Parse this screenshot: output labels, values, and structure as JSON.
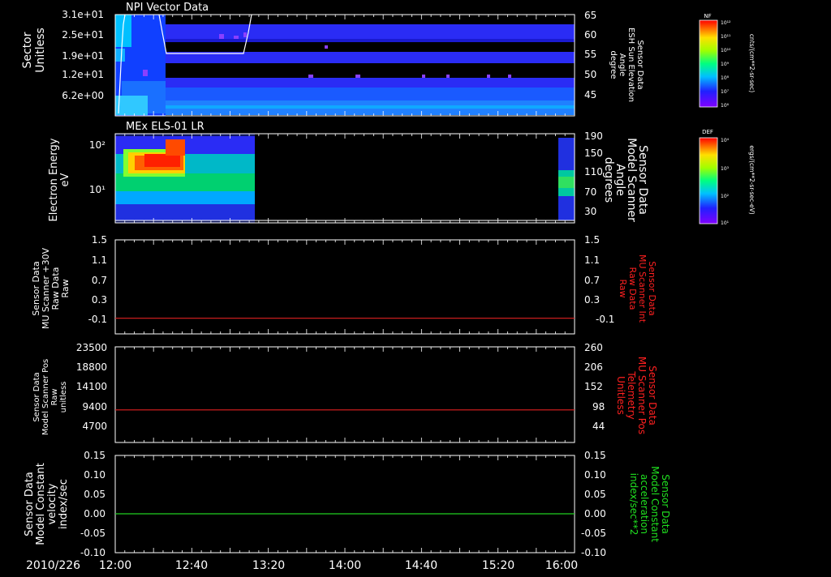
{
  "date_label": "2010/226",
  "time_ticks": [
    "12:00",
    "12:40",
    "13:20",
    "14:00",
    "14:40",
    "15:20",
    "16:00"
  ],
  "chart_data": [
    {
      "type": "heatmap",
      "title": "NPI Vector Data",
      "ylabel": [
        "Sector",
        "Unitless"
      ],
      "y_ticks": [
        "3.1e+01",
        "2.5e+01",
        "1.9e+01",
        "1.2e+01",
        "6.2e+00"
      ],
      "right_label": [
        "Sensor Data",
        "ESH Sun Elevation",
        "Angle",
        "degree"
      ],
      "right_ticks": [
        "65",
        "60",
        "55",
        "50",
        "45"
      ],
      "colorbar": {
        "tag": "NF",
        "ticks": [
          "10¹²",
          "10¹¹",
          "10¹⁰",
          "10⁹",
          "10⁸",
          "10⁷",
          "10⁶"
        ],
        "units": "cnts/(cm**2-sr-sec)"
      }
    },
    {
      "type": "heatmap",
      "title": "MEx ELS-01 LR",
      "ylabel": [
        "Electron Energy",
        "eV"
      ],
      "y_ticks": [
        "10²",
        "10¹"
      ],
      "right_label": [
        "Sensor Data",
        "Model Scanner",
        "Angle",
        "degrees"
      ],
      "right_ticks": [
        "190",
        "150",
        "110",
        "70",
        "30"
      ],
      "colorbar": {
        "tag": "DEF",
        "ticks": [
          "10⁴",
          "10³",
          "10²",
          "10¹"
        ],
        "units": "ergs/(cm**2-sr-sec-eV)"
      }
    },
    {
      "type": "line",
      "ylabel": [
        "Sensor Data",
        "MU Scanner +30V",
        "Raw Data",
        "Raw"
      ],
      "y_ticks": [
        "1.5",
        "1.1",
        "0.7",
        "0.3",
        "-0.1"
      ],
      "ylim": [
        -0.3,
        1.5
      ],
      "right_label": [
        "Sensor Data",
        "MU Scanner Int",
        "Raw Data",
        "Raw"
      ],
      "right_ticks": [
        "1.5",
        "1.1",
        "0.7",
        "0.3",
        "-0.1"
      ],
      "right_color": "#ff2020",
      "series": [
        {
          "color": "#e02020",
          "x": [
            "12:00",
            "16:00"
          ],
          "values": [
            0.0,
            0.0
          ]
        }
      ]
    },
    {
      "type": "line",
      "ylabel": [
        "Sensor Data",
        "Model Scanner Pos",
        "Raw",
        "unitless"
      ],
      "y_ticks": [
        "23500",
        "18800",
        "14100",
        "9400",
        "4700"
      ],
      "ylim": [
        0,
        23500
      ],
      "right_label": [
        "Sensor Data",
        "MU Scanner Pos",
        "Telemetry",
        "Unitless"
      ],
      "right_ticks": [
        "260",
        "206",
        "152",
        "98",
        "44"
      ],
      "right_color": "#ff2020",
      "series": [
        {
          "color": "#e02020",
          "x": [
            "12:00",
            "16:00"
          ],
          "values": [
            8000,
            8000
          ]
        }
      ]
    },
    {
      "type": "line",
      "ylabel": [
        "Sensor Data",
        "Model Constant",
        "velocity",
        "index/sec"
      ],
      "y_ticks": [
        "0.15",
        "0.10",
        "0.05",
        "0.00",
        "-0.05",
        "-0.10"
      ],
      "ylim": [
        -0.1,
        0.15
      ],
      "right_label": [
        "Sensor Data",
        "Model Constant",
        "acceleration",
        "index/sec**2"
      ],
      "right_ticks": [
        "0.15",
        "0.10",
        "0.05",
        "0.00",
        "-0.05",
        "-0.10"
      ],
      "right_color": "#20e020",
      "series": [
        {
          "color": "#20d020",
          "x": [
            "12:00",
            "16:00"
          ],
          "values": [
            0.0,
            0.0
          ]
        }
      ]
    }
  ]
}
